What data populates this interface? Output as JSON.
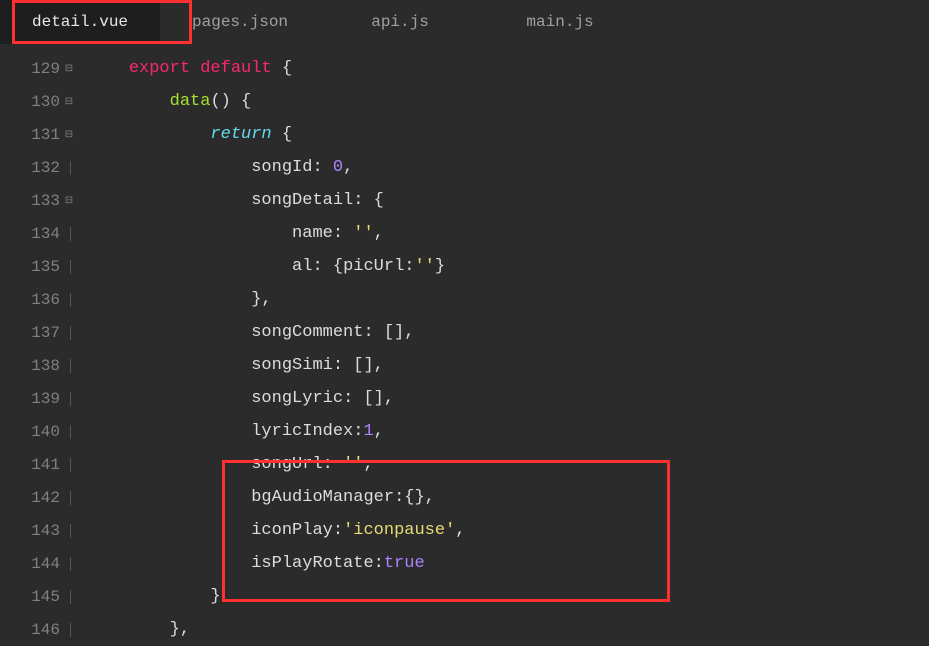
{
  "tabs": [
    {
      "label": "detail.vue",
      "active": true
    },
    {
      "label": "pages.json",
      "active": false
    },
    {
      "label": "api.js",
      "active": false
    },
    {
      "label": "main.js",
      "active": false
    }
  ],
  "code": {
    "lines": [
      {
        "num": "129",
        "fold": "open",
        "indent": 1,
        "tokens": [
          [
            "keyword",
            "export"
          ],
          [
            "plain",
            " "
          ],
          [
            "keyword",
            "default"
          ],
          [
            "plain",
            " "
          ],
          [
            "punc",
            "{"
          ]
        ]
      },
      {
        "num": "130",
        "fold": "open",
        "indent": 2,
        "tokens": [
          [
            "func",
            "data"
          ],
          [
            "punc",
            "()"
          ],
          [
            "plain",
            " "
          ],
          [
            "punc",
            "{"
          ]
        ]
      },
      {
        "num": "131",
        "fold": "open",
        "indent": 3,
        "tokens": [
          [
            "keyword2",
            "return"
          ],
          [
            "plain",
            " "
          ],
          [
            "punc",
            "{"
          ]
        ]
      },
      {
        "num": "132",
        "fold": "",
        "indent": 4,
        "tokens": [
          [
            "prop",
            "songId"
          ],
          [
            "punc",
            ": "
          ],
          [
            "number",
            "0"
          ],
          [
            "punc",
            ","
          ]
        ]
      },
      {
        "num": "133",
        "fold": "open",
        "indent": 4,
        "tokens": [
          [
            "prop",
            "songDetail"
          ],
          [
            "punc",
            ": {"
          ]
        ]
      },
      {
        "num": "134",
        "fold": "",
        "indent": 5,
        "tokens": [
          [
            "prop",
            "name"
          ],
          [
            "punc",
            ": "
          ],
          [
            "string",
            "''"
          ],
          [
            "punc",
            ","
          ]
        ]
      },
      {
        "num": "135",
        "fold": "",
        "indent": 5,
        "tokens": [
          [
            "prop",
            "al"
          ],
          [
            "punc",
            ": {"
          ],
          [
            "prop",
            "picUrl"
          ],
          [
            "punc",
            ":"
          ],
          [
            "string",
            "''"
          ],
          [
            "punc",
            "}"
          ]
        ]
      },
      {
        "num": "136",
        "fold": "",
        "indent": 4,
        "tokens": [
          [
            "punc",
            "},"
          ]
        ]
      },
      {
        "num": "137",
        "fold": "",
        "indent": 4,
        "tokens": [
          [
            "prop",
            "songComment"
          ],
          [
            "punc",
            ": [],"
          ]
        ]
      },
      {
        "num": "138",
        "fold": "",
        "indent": 4,
        "tokens": [
          [
            "prop",
            "songSimi"
          ],
          [
            "punc",
            ": [],"
          ]
        ]
      },
      {
        "num": "139",
        "fold": "",
        "indent": 4,
        "tokens": [
          [
            "prop",
            "songLyric"
          ],
          [
            "punc",
            ": [],"
          ]
        ]
      },
      {
        "num": "140",
        "fold": "",
        "indent": 4,
        "tokens": [
          [
            "prop",
            "lyricIndex"
          ],
          [
            "punc",
            ":"
          ],
          [
            "number",
            "1"
          ],
          [
            "punc",
            ","
          ]
        ]
      },
      {
        "num": "141",
        "fold": "",
        "indent": 4,
        "tokens": [
          [
            "prop",
            "songUrl"
          ],
          [
            "punc",
            ": "
          ],
          [
            "string",
            "''"
          ],
          [
            "punc",
            ","
          ]
        ]
      },
      {
        "num": "142",
        "fold": "",
        "indent": 4,
        "tokens": [
          [
            "prop",
            "bgAudioManager"
          ],
          [
            "punc",
            ":{},"
          ]
        ]
      },
      {
        "num": "143",
        "fold": "",
        "indent": 4,
        "tokens": [
          [
            "prop",
            "iconPlay"
          ],
          [
            "punc",
            ":"
          ],
          [
            "string",
            "'iconpause'"
          ],
          [
            "punc",
            ","
          ]
        ]
      },
      {
        "num": "144",
        "fold": "",
        "indent": 4,
        "tokens": [
          [
            "prop",
            "isPlayRotate"
          ],
          [
            "punc",
            ":"
          ],
          [
            "bool",
            "true"
          ]
        ]
      },
      {
        "num": "145",
        "fold": "",
        "indent": 3,
        "tokens": [
          [
            "punc",
            "}"
          ]
        ]
      },
      {
        "num": "146",
        "fold": "",
        "indent": 2,
        "tokens": [
          [
            "punc",
            "},"
          ]
        ]
      }
    ]
  }
}
